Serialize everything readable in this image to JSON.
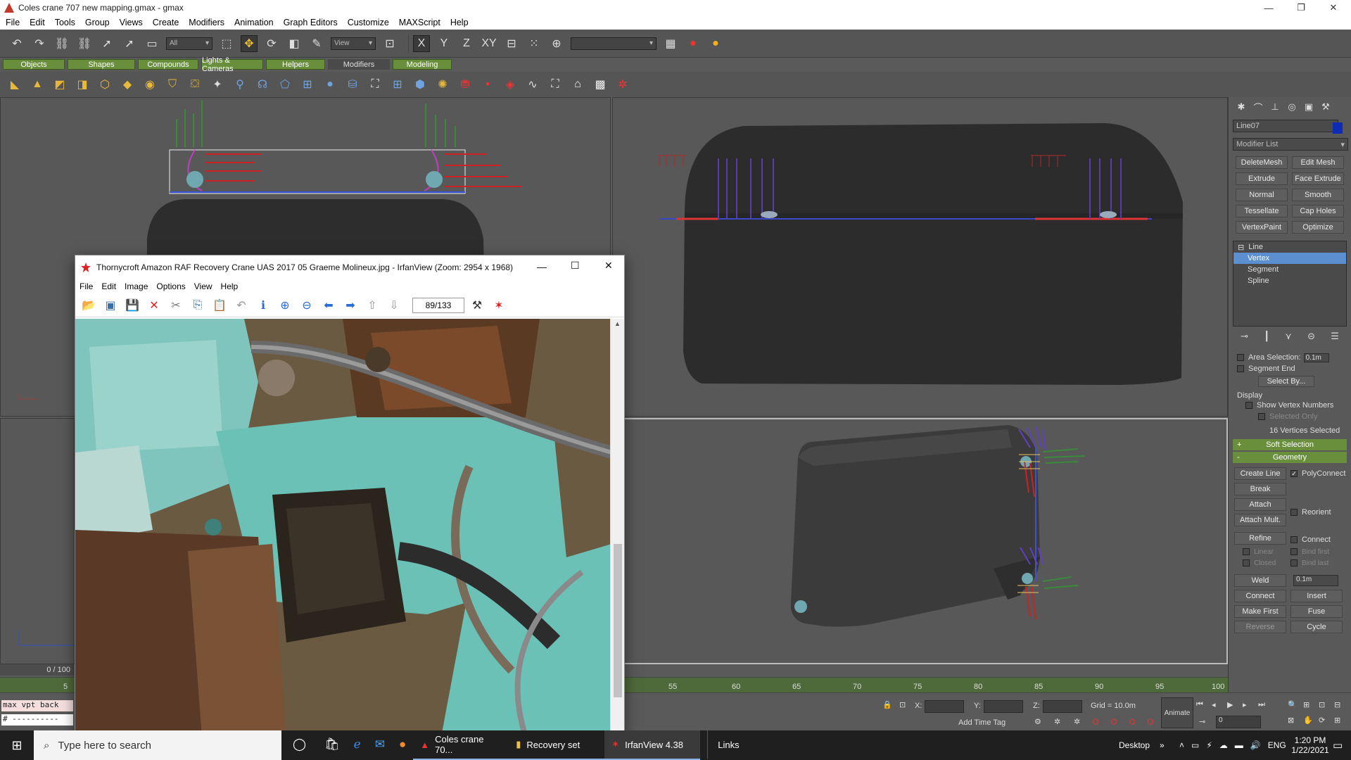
{
  "window": {
    "title": "Coles crane 707 new mapping.gmax - gmax",
    "controls": [
      "—",
      "❐",
      "✕"
    ]
  },
  "menu": [
    "File",
    "Edit",
    "Tools",
    "Group",
    "Views",
    "Create",
    "Modifiers",
    "Animation",
    "Graph Editors",
    "Customize",
    "MAXScript",
    "Help"
  ],
  "toolbar": {
    "selection_filter": "All",
    "reference_coord": "View",
    "named_sel": ""
  },
  "tabs": [
    "Objects",
    "Shapes",
    "Compounds",
    "Lights & Cameras",
    "Helpers",
    "Modifiers",
    "Modeling"
  ],
  "selected_tab": "Modifiers",
  "command_panel": {
    "object_name": "Line07",
    "object_color": "#0e2bb5",
    "modifier_list": "Modifier List",
    "modifier_buttons": [
      "DeleteMesh",
      "Edit Mesh",
      "Extrude",
      "Face Extrude",
      "Normal",
      "Smooth",
      "Tessellate",
      "Cap Holes",
      "VertexPaint",
      "Optimize"
    ],
    "stack": [
      {
        "label": "Line",
        "level": 0
      },
      {
        "label": "Vertex",
        "level": 1,
        "selected": true
      },
      {
        "label": "Segment",
        "level": 1
      },
      {
        "label": "Spline",
        "level": 1
      }
    ],
    "selection": {
      "area_selection": "Area Selection:",
      "area_value": "0.1m",
      "segment_end": "Segment End",
      "select_by": "Select By...",
      "display": "Display",
      "show_vertex_numbers": "Show Vertex Numbers",
      "selected_only": "Selected Only",
      "status": "16 Vertices Selected"
    },
    "rollouts": {
      "soft_selection": "Soft Selection",
      "geometry": "Geometry",
      "soft_sign": "+",
      "geometry_sign": "-"
    },
    "geometry": {
      "create_line": "Create Line",
      "polyconnect": "PolyConnect",
      "break": "Break",
      "attach": "Attach",
      "reorient": "Reorient",
      "attach_mult": "Attach Mult.",
      "refine": "Refine",
      "connect": "Connect",
      "linear": "Linear",
      "bind_first": "Bind first",
      "closed": "Closed",
      "bind_last": "Bind last",
      "weld": "Weld",
      "weld_value": "0.1m",
      "connect_btn": "Connect",
      "insert": "Insert",
      "make_first": "Make First",
      "fuse": "Fuse",
      "reverse": "Reverse",
      "cycle": "Cycle"
    }
  },
  "irfanview": {
    "title": "Thornycroft Amazon RAF Recovery Crane UAS 2017 05 Graeme Molineux.jpg - IrfanView (Zoom: 2954 x 1968)",
    "menu": [
      "File",
      "Edit",
      "Image",
      "Options",
      "View",
      "Help"
    ],
    "counter": "89/133",
    "controls": [
      "—",
      "☐",
      "✕"
    ]
  },
  "timeline": {
    "frame": "0 / 100",
    "ticks": [
      "5",
      "55",
      "60",
      "65",
      "70",
      "75",
      "80",
      "85",
      "90",
      "95",
      "100"
    ]
  },
  "status": {
    "maxscript_line1": "max vpt back",
    "maxscript_line2": "# ----------",
    "x_label": "X:",
    "y_label": "Y:",
    "z_label": "Z:",
    "grid": "Grid = 10.0m",
    "add_time_tag": "Add Time Tag",
    "animate": "Animate",
    "frame_value": "0"
  },
  "taskbar": {
    "search_placeholder": "Type here to search",
    "apps": [
      {
        "label": "Coles crane 70...",
        "state": "open"
      },
      {
        "label": "Recovery set",
        "state": "open"
      },
      {
        "label": "IrfanView 4.38",
        "state": "active"
      }
    ],
    "links": "Links",
    "desktop": "Desktop",
    "lang": "ENG",
    "time": "1:20 PM",
    "date": "1/22/2021"
  }
}
